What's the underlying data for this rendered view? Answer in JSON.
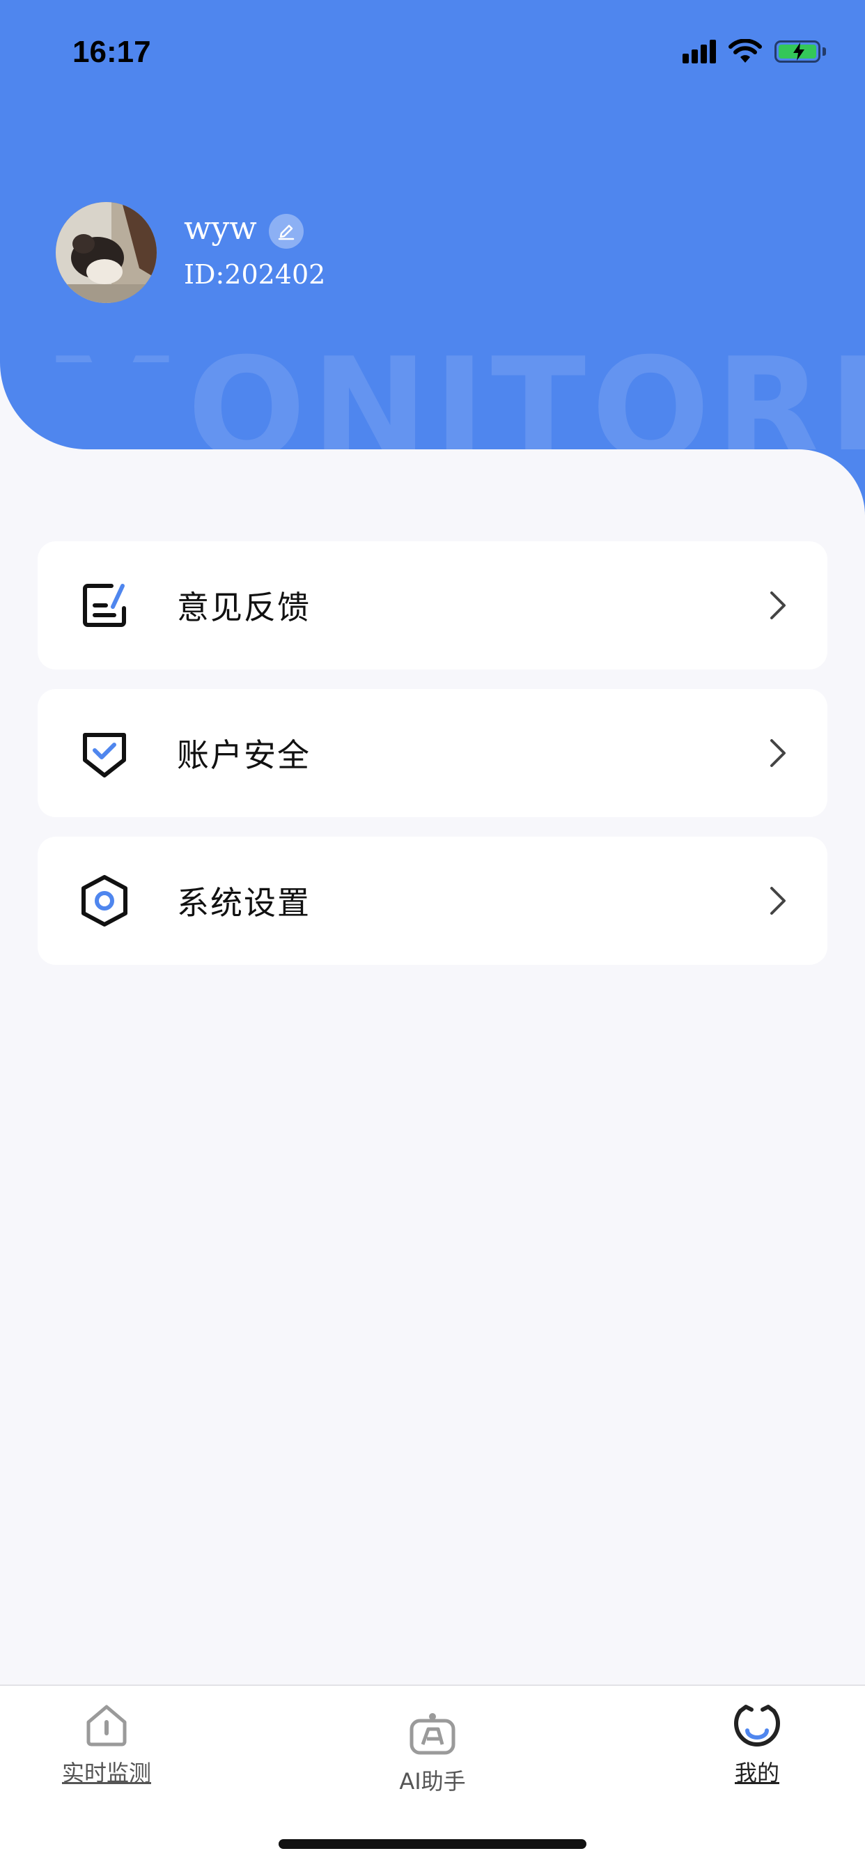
{
  "status_bar": {
    "time": "16:17"
  },
  "header": {
    "watermark": "MONITORING",
    "username": "wyw",
    "user_id": "ID:202402"
  },
  "menu": {
    "items": [
      {
        "label": "意见反馈",
        "icon": "feedback-icon"
      },
      {
        "label": "账户安全",
        "icon": "shield-check-icon"
      },
      {
        "label": "系统设置",
        "icon": "settings-hexagon-icon"
      }
    ]
  },
  "tabbar": {
    "tabs": [
      {
        "label": "实时监测",
        "icon": "home-monitor-icon"
      },
      {
        "label": "AI助手",
        "icon": "ai-assistant-icon"
      },
      {
        "label": "我的",
        "icon": "profile-icon",
        "active": true
      }
    ]
  },
  "colors": {
    "primary": "#4f86ee",
    "background": "#f7f7fb",
    "battery": "#34c759"
  }
}
